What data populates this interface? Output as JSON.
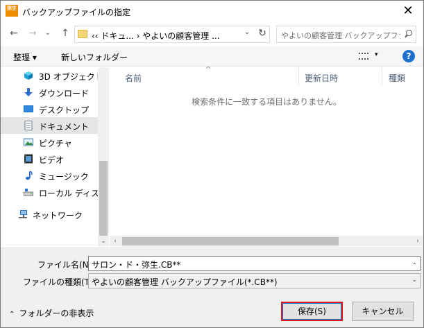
{
  "window": {
    "title": "バックアップファイルの指定",
    "app_icon_text": "弥生"
  },
  "nav": {
    "back_glyph": "←",
    "forward_glyph": "→",
    "recent_glyph": "⌄",
    "up_glyph": "↑",
    "address": "‹‹ ドキュ... › やよいの顧客管理 ...",
    "refresh_glyph": "↻",
    "search_placeholder": "やよいの顧客管理 バックアップファ..."
  },
  "commands": {
    "organize": "整理 ▾",
    "new_folder": "新しいフォルダー",
    "help": "?"
  },
  "sidebar": {
    "items": [
      {
        "label": "3D オブジェクト",
        "icon": "cube-3d-icon"
      },
      {
        "label": "ダウンロード",
        "icon": "download-arrow-icon"
      },
      {
        "label": "デスクトップ",
        "icon": "desktop-icon"
      },
      {
        "label": "ドキュメント",
        "icon": "document-icon",
        "selected": true
      },
      {
        "label": "ピクチャ",
        "icon": "pictures-icon"
      },
      {
        "label": "ビデオ",
        "icon": "video-icon"
      },
      {
        "label": "ミュージック",
        "icon": "music-note-icon"
      },
      {
        "label": "ローカル ディスク (C",
        "icon": "disk-drive-icon"
      },
      {
        "label": "ネットワーク",
        "icon": "network-icon"
      }
    ]
  },
  "list": {
    "columns": [
      "名前",
      "更新日時",
      "種類"
    ],
    "empty_message": "検索条件に一致する項目はありません。"
  },
  "form": {
    "filename_label": "ファイル名(N):",
    "filename_value": "サロン・ド・弥生.CB**",
    "filetype_label": "ファイルの種類(T):",
    "filetype_value": "やよいの顧客管理 バックアップファイル(*.CB**)",
    "hide_folders": "フォルダーの非表示",
    "save_button": "保存(S)",
    "cancel_button": "キャンセル"
  },
  "colors": {
    "accent": "#0078d7",
    "highlight_border": "#e0141e",
    "help_blue": "#1f6fd1"
  }
}
